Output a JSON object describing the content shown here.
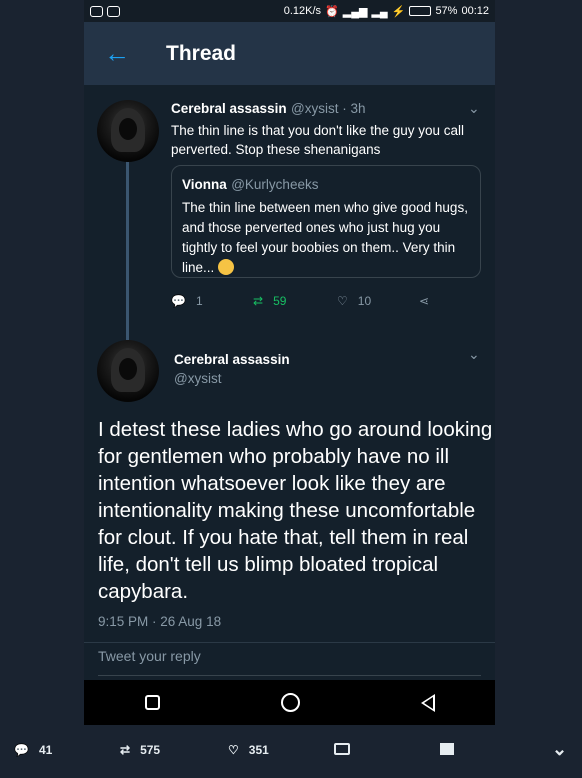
{
  "statusbar": {
    "speed": "0.12K/s",
    "battery_pct": "57%",
    "time": "00:12",
    "battery_level": 0.57
  },
  "header": {
    "title": "Thread",
    "back": "←"
  },
  "tweet1": {
    "name": "Cerebral assassin",
    "handle": "@xysist · 3h",
    "text": "The thin line is that you don't like the guy you call perverted. Stop these shenanigans",
    "quote": {
      "name": "Vionna",
      "handle": "@Kurlycheeks",
      "text": "The thin line between men who give good hugs, and those perverted ones who just hug you tightly to feel your boobies on them.. Very thin line..."
    },
    "actions": {
      "replies": "1",
      "retweets": "59",
      "likes": "10"
    }
  },
  "tweet2": {
    "name": "Cerebral assassin",
    "handle": "@xysist",
    "text": "I detest these ladies who go around looking for gentlemen who probably have no ill intention whatsoever look like they are intentionality making these uncomfortable for clout. If you hate that, tell them in real life, don't tell us blimp bloated tropical capybara.",
    "timestamp": "9:15 PM · 26 Aug 18"
  },
  "reply": {
    "placeholder": "Tweet your reply"
  },
  "bottom_bar": {
    "replies": "41",
    "retweets": "575",
    "likes": "351"
  }
}
